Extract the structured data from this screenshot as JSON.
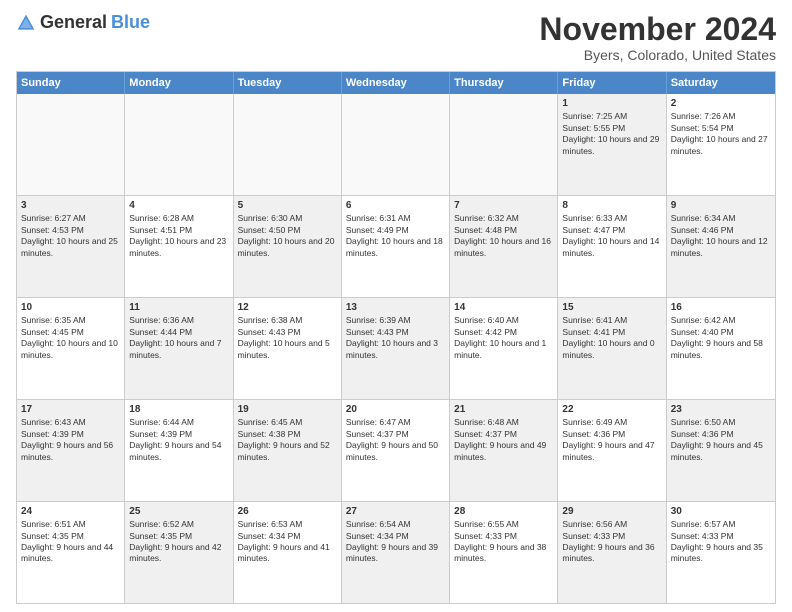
{
  "logo": {
    "general": "General",
    "blue": "Blue"
  },
  "title": "November 2024",
  "location": "Byers, Colorado, United States",
  "days_of_week": [
    "Sunday",
    "Monday",
    "Tuesday",
    "Wednesday",
    "Thursday",
    "Friday",
    "Saturday"
  ],
  "rows": [
    [
      {
        "day": "",
        "info": "",
        "empty": true
      },
      {
        "day": "",
        "info": "",
        "empty": true
      },
      {
        "day": "",
        "info": "",
        "empty": true
      },
      {
        "day": "",
        "info": "",
        "empty": true
      },
      {
        "day": "",
        "info": "",
        "empty": true
      },
      {
        "day": "1",
        "info": "Sunrise: 7:25 AM\nSunset: 5:55 PM\nDaylight: 10 hours and 29 minutes.",
        "shaded": true
      },
      {
        "day": "2",
        "info": "Sunrise: 7:26 AM\nSunset: 5:54 PM\nDaylight: 10 hours and 27 minutes.",
        "shaded": false
      }
    ],
    [
      {
        "day": "3",
        "info": "Sunrise: 6:27 AM\nSunset: 4:53 PM\nDaylight: 10 hours and 25 minutes.",
        "shaded": true
      },
      {
        "day": "4",
        "info": "Sunrise: 6:28 AM\nSunset: 4:51 PM\nDaylight: 10 hours and 23 minutes.",
        "shaded": false
      },
      {
        "day": "5",
        "info": "Sunrise: 6:30 AM\nSunset: 4:50 PM\nDaylight: 10 hours and 20 minutes.",
        "shaded": true
      },
      {
        "day": "6",
        "info": "Sunrise: 6:31 AM\nSunset: 4:49 PM\nDaylight: 10 hours and 18 minutes.",
        "shaded": false
      },
      {
        "day": "7",
        "info": "Sunrise: 6:32 AM\nSunset: 4:48 PM\nDaylight: 10 hours and 16 minutes.",
        "shaded": true
      },
      {
        "day": "8",
        "info": "Sunrise: 6:33 AM\nSunset: 4:47 PM\nDaylight: 10 hours and 14 minutes.",
        "shaded": false
      },
      {
        "day": "9",
        "info": "Sunrise: 6:34 AM\nSunset: 4:46 PM\nDaylight: 10 hours and 12 minutes.",
        "shaded": true
      }
    ],
    [
      {
        "day": "10",
        "info": "Sunrise: 6:35 AM\nSunset: 4:45 PM\nDaylight: 10 hours and 10 minutes.",
        "shaded": false
      },
      {
        "day": "11",
        "info": "Sunrise: 6:36 AM\nSunset: 4:44 PM\nDaylight: 10 hours and 7 minutes.",
        "shaded": true
      },
      {
        "day": "12",
        "info": "Sunrise: 6:38 AM\nSunset: 4:43 PM\nDaylight: 10 hours and 5 minutes.",
        "shaded": false
      },
      {
        "day": "13",
        "info": "Sunrise: 6:39 AM\nSunset: 4:43 PM\nDaylight: 10 hours and 3 minutes.",
        "shaded": true
      },
      {
        "day": "14",
        "info": "Sunrise: 6:40 AM\nSunset: 4:42 PM\nDaylight: 10 hours and 1 minute.",
        "shaded": false
      },
      {
        "day": "15",
        "info": "Sunrise: 6:41 AM\nSunset: 4:41 PM\nDaylight: 10 hours and 0 minutes.",
        "shaded": true
      },
      {
        "day": "16",
        "info": "Sunrise: 6:42 AM\nSunset: 4:40 PM\nDaylight: 9 hours and 58 minutes.",
        "shaded": false
      }
    ],
    [
      {
        "day": "17",
        "info": "Sunrise: 6:43 AM\nSunset: 4:39 PM\nDaylight: 9 hours and 56 minutes.",
        "shaded": true
      },
      {
        "day": "18",
        "info": "Sunrise: 6:44 AM\nSunset: 4:39 PM\nDaylight: 9 hours and 54 minutes.",
        "shaded": false
      },
      {
        "day": "19",
        "info": "Sunrise: 6:45 AM\nSunset: 4:38 PM\nDaylight: 9 hours and 52 minutes.",
        "shaded": true
      },
      {
        "day": "20",
        "info": "Sunrise: 6:47 AM\nSunset: 4:37 PM\nDaylight: 9 hours and 50 minutes.",
        "shaded": false
      },
      {
        "day": "21",
        "info": "Sunrise: 6:48 AM\nSunset: 4:37 PM\nDaylight: 9 hours and 49 minutes.",
        "shaded": true
      },
      {
        "day": "22",
        "info": "Sunrise: 6:49 AM\nSunset: 4:36 PM\nDaylight: 9 hours and 47 minutes.",
        "shaded": false
      },
      {
        "day": "23",
        "info": "Sunrise: 6:50 AM\nSunset: 4:36 PM\nDaylight: 9 hours and 45 minutes.",
        "shaded": true
      }
    ],
    [
      {
        "day": "24",
        "info": "Sunrise: 6:51 AM\nSunset: 4:35 PM\nDaylight: 9 hours and 44 minutes.",
        "shaded": false
      },
      {
        "day": "25",
        "info": "Sunrise: 6:52 AM\nSunset: 4:35 PM\nDaylight: 9 hours and 42 minutes.",
        "shaded": true
      },
      {
        "day": "26",
        "info": "Sunrise: 6:53 AM\nSunset: 4:34 PM\nDaylight: 9 hours and 41 minutes.",
        "shaded": false
      },
      {
        "day": "27",
        "info": "Sunrise: 6:54 AM\nSunset: 4:34 PM\nDaylight: 9 hours and 39 minutes.",
        "shaded": true
      },
      {
        "day": "28",
        "info": "Sunrise: 6:55 AM\nSunset: 4:33 PM\nDaylight: 9 hours and 38 minutes.",
        "shaded": false
      },
      {
        "day": "29",
        "info": "Sunrise: 6:56 AM\nSunset: 4:33 PM\nDaylight: 9 hours and 36 minutes.",
        "shaded": true
      },
      {
        "day": "30",
        "info": "Sunrise: 6:57 AM\nSunset: 4:33 PM\nDaylight: 9 hours and 35 minutes.",
        "shaded": false
      }
    ]
  ]
}
